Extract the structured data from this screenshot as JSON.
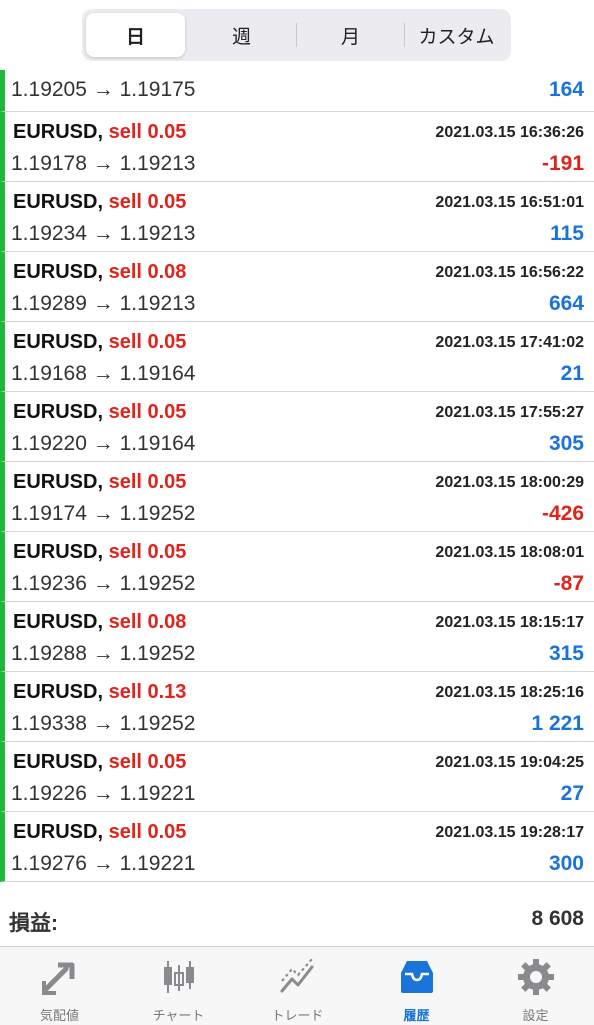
{
  "segmented": [
    "日",
    "週",
    "月",
    "カスタム"
  ],
  "first_row": {
    "prices": "1.19205 → 1.19175",
    "profit": "164"
  },
  "trades": [
    {
      "symbol": "EURUSD,",
      "side": "sell 0.05",
      "time": "2021.03.15 16:36:26",
      "prices": "1.19178 → 1.19213",
      "profit": "-191"
    },
    {
      "symbol": "EURUSD,",
      "side": "sell 0.05",
      "time": "2021.03.15 16:51:01",
      "prices": "1.19234 → 1.19213",
      "profit": "115"
    },
    {
      "symbol": "EURUSD,",
      "side": "sell 0.08",
      "time": "2021.03.15 16:56:22",
      "prices": "1.19289 → 1.19213",
      "profit": "664"
    },
    {
      "symbol": "EURUSD,",
      "side": "sell 0.05",
      "time": "2021.03.15 17:41:02",
      "prices": "1.19168 → 1.19164",
      "profit": "21"
    },
    {
      "symbol": "EURUSD,",
      "side": "sell 0.05",
      "time": "2021.03.15 17:55:27",
      "prices": "1.19220 → 1.19164",
      "profit": "305"
    },
    {
      "symbol": "EURUSD,",
      "side": "sell 0.05",
      "time": "2021.03.15 18:00:29",
      "prices": "1.19174 → 1.19252",
      "profit": "-426"
    },
    {
      "symbol": "EURUSD,",
      "side": "sell 0.05",
      "time": "2021.03.15 18:08:01",
      "prices": "1.19236 → 1.19252",
      "profit": "-87"
    },
    {
      "symbol": "EURUSD,",
      "side": "sell 0.08",
      "time": "2021.03.15 18:15:17",
      "prices": "1.19288 → 1.19252",
      "profit": "315"
    },
    {
      "symbol": "EURUSD,",
      "side": "sell 0.13",
      "time": "2021.03.15 18:25:16",
      "prices": "1.19338 → 1.19252",
      "profit": "1 221"
    },
    {
      "symbol": "EURUSD,",
      "side": "sell 0.05",
      "time": "2021.03.15 19:04:25",
      "prices": "1.19226 → 1.19221",
      "profit": "27"
    },
    {
      "symbol": "EURUSD,",
      "side": "sell 0.05",
      "time": "2021.03.15 19:28:17",
      "prices": "1.19276 → 1.19221",
      "profit": "300"
    }
  ],
  "summary": {
    "label": "損益:",
    "value": "8 608"
  },
  "tabs": [
    {
      "label": "気配値",
      "icon": "quotes-icon"
    },
    {
      "label": "チャート",
      "icon": "chart-icon"
    },
    {
      "label": "トレード",
      "icon": "trade-icon"
    },
    {
      "label": "履歴",
      "icon": "history-icon"
    },
    {
      "label": "設定",
      "icon": "settings-icon"
    }
  ],
  "colors": {
    "accent": "#1a73d9",
    "loss": "#e0241b",
    "row_marker": "#1fb83c"
  }
}
